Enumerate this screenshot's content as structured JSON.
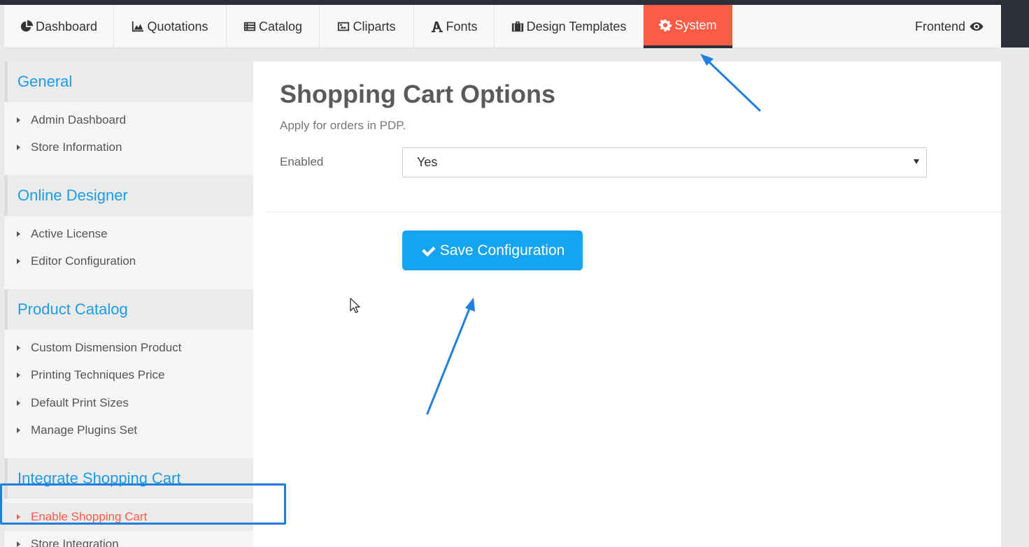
{
  "nav": {
    "tabs": [
      {
        "label": "Dashboard",
        "icon": "pie-chart-icon"
      },
      {
        "label": "Quotations",
        "icon": "area-chart-icon"
      },
      {
        "label": "Catalog",
        "icon": "list-icon"
      },
      {
        "label": "Cliparts",
        "icon": "image-icon"
      },
      {
        "label": "Fonts",
        "icon": "font-icon"
      },
      {
        "label": "Design Templates",
        "icon": "briefcase-icon"
      },
      {
        "label": "System",
        "icon": "gear-icon"
      }
    ],
    "frontend_label": "Frontend",
    "active_color": "#fc5b45"
  },
  "sidebar": {
    "sections": [
      {
        "title": "General",
        "items": [
          "Admin Dashboard",
          "Store Information"
        ]
      },
      {
        "title": "Online Designer",
        "items": [
          "Active License",
          "Editor Configuration"
        ]
      },
      {
        "title": "Product Catalog",
        "items": [
          "Custom Dismension Product",
          "Printing Techniques Price",
          "Default Print Sizes",
          "Manage Plugins Set"
        ]
      },
      {
        "title": "Integrate Shopping Cart",
        "items": [
          "Enable Shopping Cart",
          "Store Integration"
        ]
      }
    ],
    "active_item": "Enable Shopping Cart",
    "header_color": "#1e9be9"
  },
  "main": {
    "title": "Shopping Cart Options",
    "subtitle": "Apply for orders in PDP.",
    "field_label": "Enabled",
    "field_value": "Yes",
    "save_label": "Save Configuration",
    "button_color": "#14a4f0"
  }
}
